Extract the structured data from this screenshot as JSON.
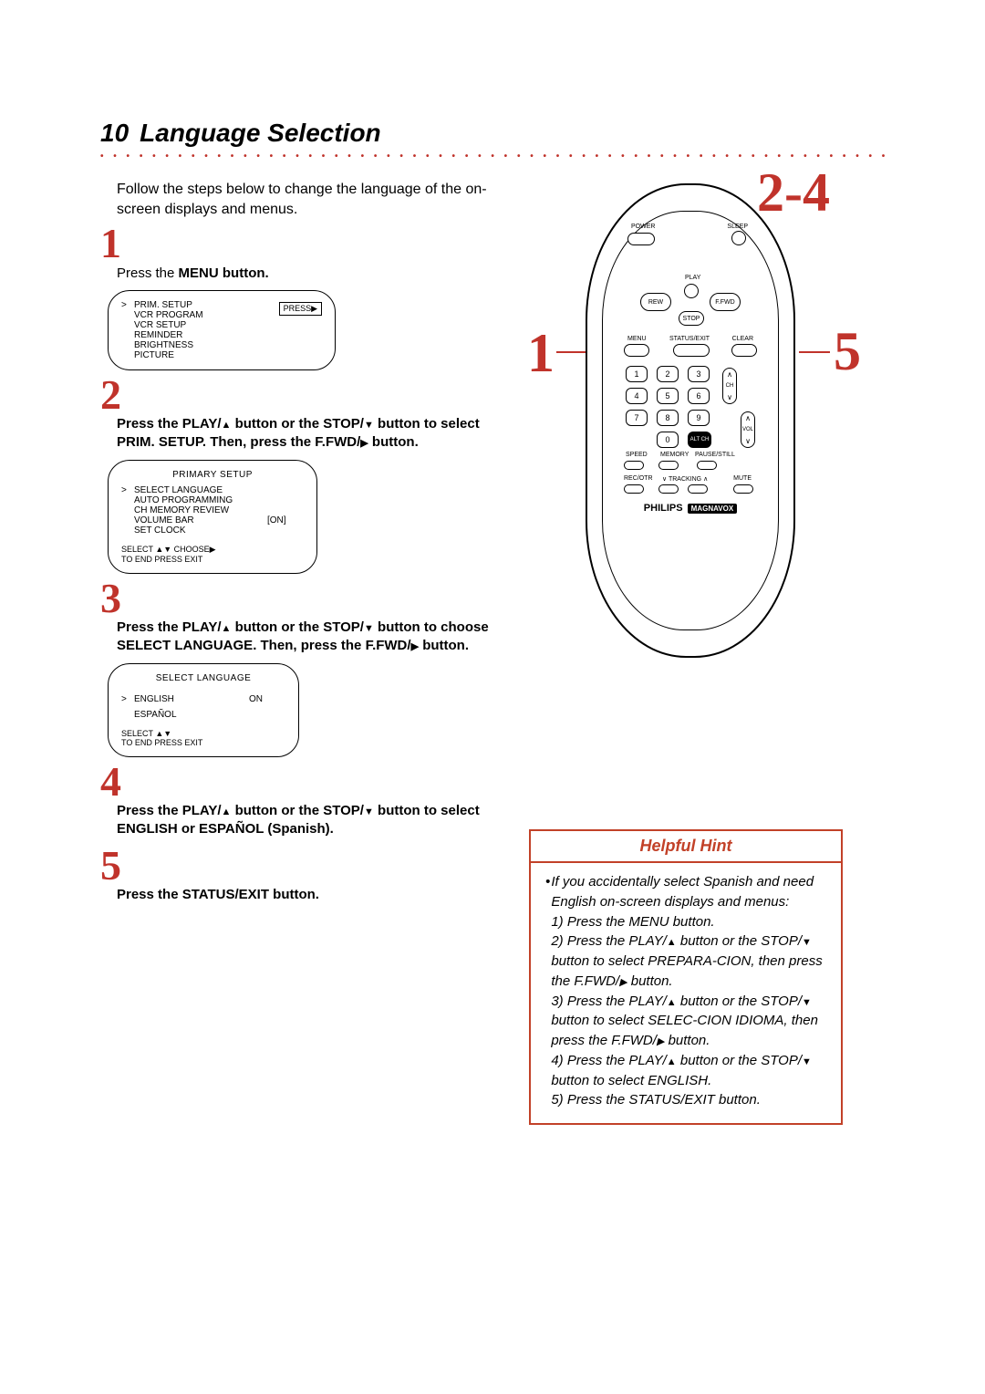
{
  "header": {
    "page_number": "10",
    "title": "Language Selection"
  },
  "intro": "Follow the steps below to change the language of the on-screen displays and menus.",
  "steps": {
    "s1": {
      "num": "1",
      "text_a": "Press the ",
      "text_b": "MENU",
      "text_c": " button."
    },
    "s2": {
      "num": "2",
      "p1": "Press the ",
      "p2": "PLAY/",
      "p3": " button or the ",
      "p4": "STOP/",
      "p5": " button to select ",
      "p6": "PRIM. SETUP",
      "p7": ". Then, press the ",
      "p8": "F.FWD/",
      "p9": " button."
    },
    "s3": {
      "num": "3",
      "p1": "Press the ",
      "p2": "PLAY/",
      "p3": " button or the ",
      "p4": "STOP/",
      "p5": " button to choose ",
      "p6": "SELECT LANGUAGE",
      "p7": ". Then, press the ",
      "p8": "F.FWD/",
      "p9": " button."
    },
    "s4": {
      "num": "4",
      "p1": "Press the ",
      "p2": "PLAY/",
      "p3": " button or the ",
      "p4": "STOP/",
      "p5": " button to select ",
      "p6": "ENGLISH",
      "p7": " or ",
      "p8": "ESPAÑOL (Spanish)",
      "p9": "."
    },
    "s5": {
      "num": "5",
      "text_a": "Press the ",
      "text_b": "STATUS/EXIT",
      "text_c": " button."
    }
  },
  "osd1": {
    "pressbox": "PRESS▶",
    "items": [
      "PRIM. SETUP",
      "VCR PROGRAM",
      "VCR SETUP",
      "REMINDER",
      "BRIGHTNESS",
      "PICTURE"
    ]
  },
  "osd2": {
    "title": "PRIMARY SETUP",
    "items": [
      {
        "label": "SELECT LANGUAGE",
        "val": ""
      },
      {
        "label": "AUTO PROGRAMMING",
        "val": ""
      },
      {
        "label": "CH MEMORY REVIEW",
        "val": ""
      },
      {
        "label": "VOLUME BAR",
        "val": "[ON]"
      },
      {
        "label": "SET CLOCK",
        "val": ""
      }
    ],
    "footer1": "SELECT ▲▼  CHOOSE▶",
    "footer2": "TO   END   PRESS  EXIT"
  },
  "osd3": {
    "title": "SELECT LANGUAGE",
    "items": [
      {
        "label": "ENGLISH",
        "val": "ON"
      },
      {
        "label": "ESPAÑOL",
        "val": ""
      }
    ],
    "footer1": "SELECT ▲▼",
    "footer2": "TO   END   PRESS  EXIT"
  },
  "callouts": {
    "tr": "2-4",
    "left": "1",
    "right": "5"
  },
  "remote": {
    "power": "POWER",
    "sleep": "SLEEP",
    "play": "PLAY",
    "rew": "REW",
    "ffwd": "F.FWD",
    "stop": "STOP",
    "menu": "MENU",
    "status": "STATUS/EXIT",
    "clear": "CLEAR",
    "digits": [
      "1",
      "2",
      "3",
      "4",
      "5",
      "6",
      "7",
      "8",
      "9",
      "0"
    ],
    "alt": "ALT CH",
    "ch": "CH",
    "vol": "VOL",
    "speed": "SPEED",
    "memory": "MEMORY",
    "pausestill": "PAUSE/STILL",
    "recotr": "REC/OTR",
    "tracking": "TRACKING",
    "mute": "MUTE",
    "brand1": "PHILIPS",
    "brand2": "MAGNAVOX"
  },
  "hint": {
    "title": "Helpful Hint",
    "lead": "If you accidentally select Spanish and need English on-screen displays and menus:",
    "l1": "1) Press the MENU button.",
    "l2a": "2) Press the PLAY/",
    "l2b": " button or the STOP/",
    "l2c": " button to select PREPARA-CION, then press the F.FWD/",
    "l2d": " button.",
    "l3a": "3) Press the PLAY/",
    "l3b": " button or the STOP/",
    "l3c": " button to select SELEC-CION IDIOMA, then press the F.FWD/",
    "l3d": " button.",
    "l4a": "4) Press the PLAY/",
    "l4b": " button or the STOP/",
    "l4c": " button to select ENGLISH.",
    "l5": "5) Press the STATUS/EXIT button."
  }
}
